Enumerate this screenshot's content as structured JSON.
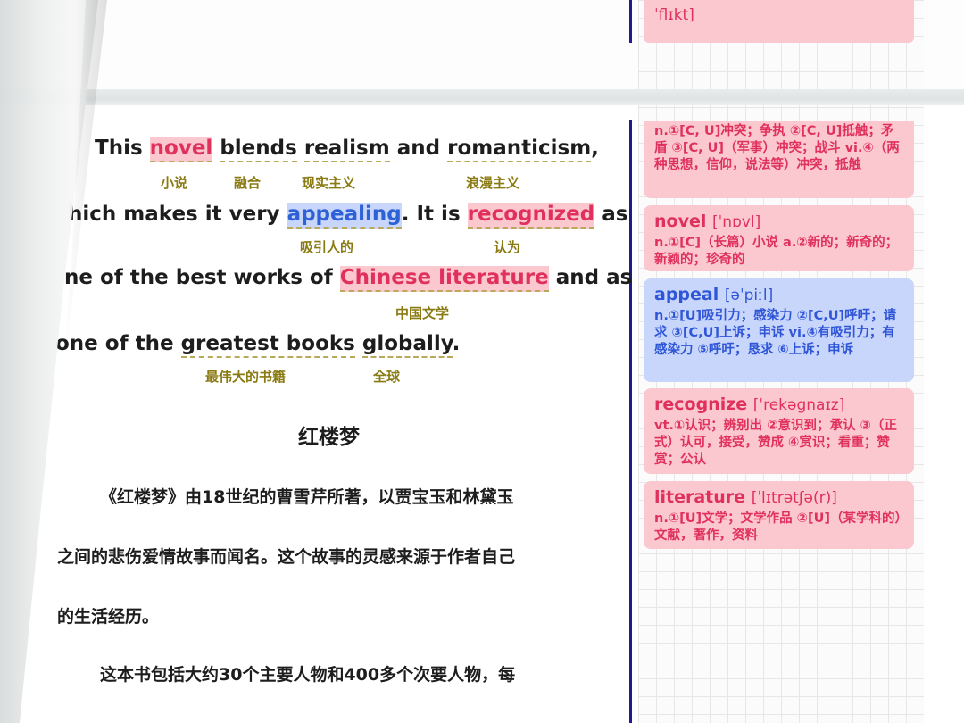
{
  "top_card": {
    "phonetic_tail": "ˈflɪkt]"
  },
  "cards": [
    {
      "def": "n.①[C, U]冲突；争执 ②[C, U]抵触；矛盾 ③[C, U]（军事）冲突；战斗 vi.④（两种思想，信仰，说法等）冲突，抵触"
    },
    {
      "word": "novel",
      "phonetic": "[ˈnɒvl]",
      "def": "n.①[C]（长篇）小说 a.②新的；新奇的；新颖的；珍奇的"
    },
    {
      "word": "appeal",
      "phonetic": "[əˈpiːl]",
      "def": "n.①[U]吸引力；感染力 ②[C,U]呼吁；请求 ③[C,U]上诉；申诉 vi.④有吸引力；有感染力 ⑤呼吁；恳求 ⑥上诉；申诉"
    },
    {
      "word": "recognize",
      "phonetic": "[ˈrekəgnaɪz]",
      "def": "vt.①认识；辨别出 ②意识到；承认 ③（正式）认可，接受，赞成 ④赏识；看重；赞赏；公认"
    },
    {
      "word": "literature",
      "phonetic": "[ˈlɪtrətʃə(r)]",
      "def": "n.①[U]文学；文学作品 ②[U]（某学科的）文献，著作，资料"
    }
  ],
  "english": {
    "line1": {
      "this": "This",
      "novel": "novel",
      "blends": "blends",
      "realism": "realism",
      "and": "and",
      "romanticism": "romanticism",
      "comma": ","
    },
    "line2": {
      "which": "hich makes it very",
      "appealing": "appealing",
      "it_is": ". It is",
      "recognized": "recognized",
      "as": "as"
    },
    "line3": {
      "one_of": "ne of the best works of",
      "chinese_literature": "Chinese literature",
      "and_as": "and as"
    },
    "line4": {
      "one_of": "one of the",
      "greatest_books": "greatest books",
      "globally": "globally",
      "period": "."
    }
  },
  "glosses": {
    "novel": "小说",
    "blends": "融合",
    "realism": "现实主义",
    "romanticism": "浪漫主义",
    "appealing": "吸引人的",
    "recognized": "认为",
    "chinese_literature": "中国文学",
    "greatest_books": "最伟大的书籍",
    "globally": "全球"
  },
  "chinese": {
    "title": "红楼梦",
    "p1_l1": "《红楼梦》由18世纪的曹雪芹所著，以贾宝玉和林黛玉",
    "p1_l2": "之间的悲伤爱情故事而闻名。这个故事的灵感来源于作者自己",
    "p1_l3": "的生活经历。",
    "p2_l1": "这本书包括大约30个主要人物和400多个次要人物，每"
  }
}
